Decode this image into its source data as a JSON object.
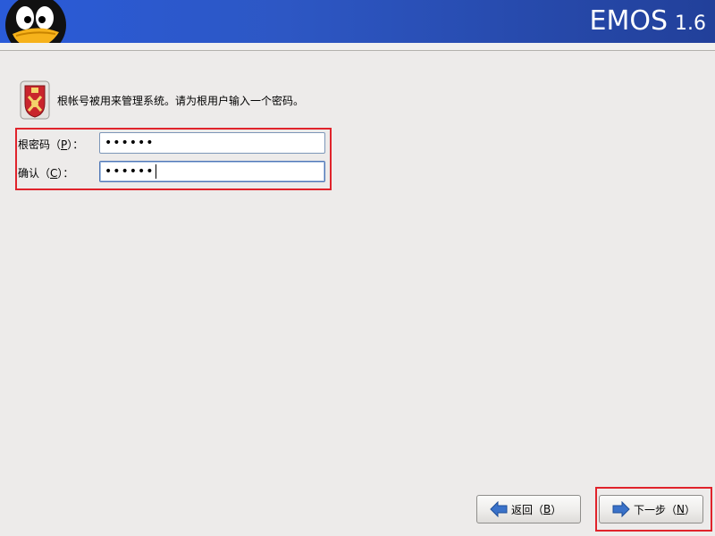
{
  "header": {
    "brand_name": "EMOS",
    "brand_version": "1.6"
  },
  "intro": {
    "icon": "security-shield-icon",
    "text": "根帐号被用来管理系统。请为根用户输入一个密码。"
  },
  "form": {
    "root_password": {
      "label_prefix": "根密码（",
      "label_mnemonic": "P",
      "label_suffix": "）：",
      "masked_value": "••••••"
    },
    "confirm": {
      "label_prefix": "确认（",
      "label_mnemonic": "C",
      "label_suffix": "）：",
      "masked_value": "••••••"
    }
  },
  "buttons": {
    "back": {
      "label_prefix": "返回（",
      "label_mnemonic": "B",
      "label_suffix": "）",
      "icon": "left-arrow-icon"
    },
    "next": {
      "label_prefix": "下一步（",
      "label_mnemonic": "N",
      "label_suffix": "）",
      "icon": "right-arrow-icon"
    }
  },
  "colors": {
    "header_blue": "#2a5bd8",
    "highlight_red": "#e0232b",
    "arrow_blue": "#3a72c9"
  }
}
